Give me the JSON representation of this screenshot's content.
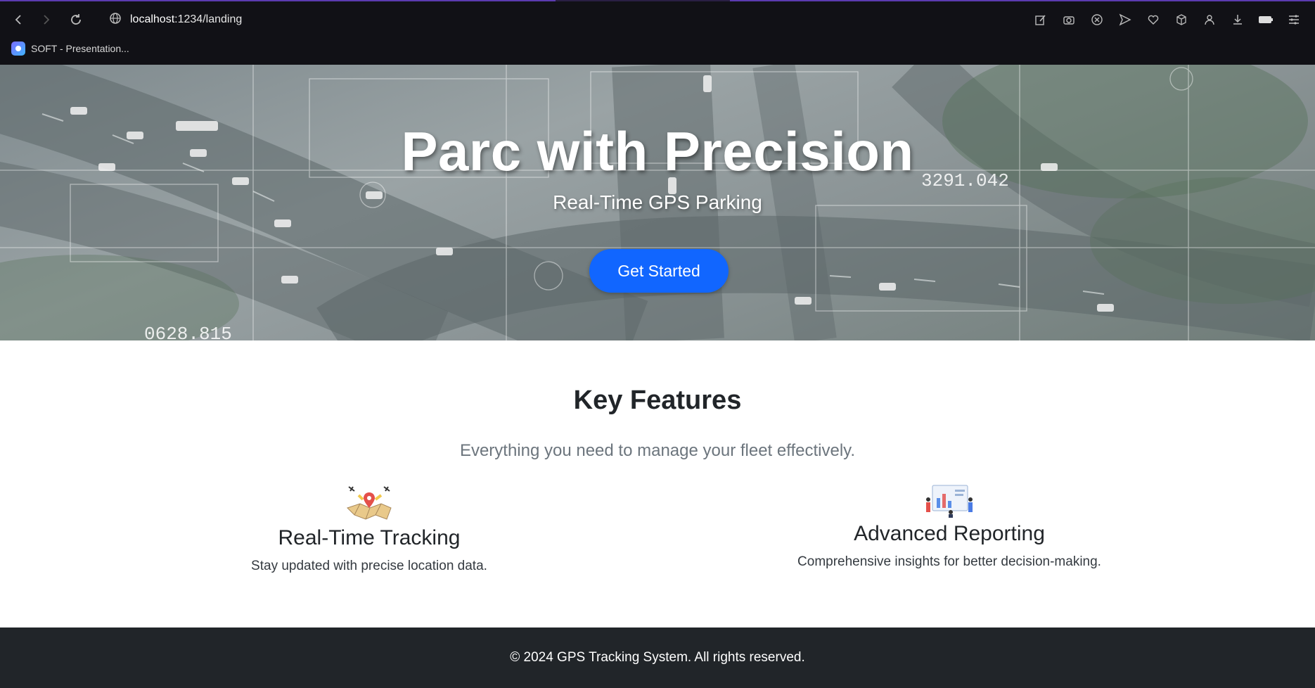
{
  "browser": {
    "url_host": "localhost",
    "url_path": ":1234/landing",
    "bookmark_label": "SOFT - Presentation..."
  },
  "hero": {
    "title": "Parc with Precision",
    "subtitle": "Real-Time GPS Parking",
    "cta_label": "Get Started",
    "overlay_number_right": "3291.042",
    "overlay_number_left": "0628.815"
  },
  "features": {
    "title": "Key Features",
    "subtitle": "Everything you need to manage your fleet effectively.",
    "items": [
      {
        "title": "Real-Time Tracking",
        "description": "Stay updated with precise location data."
      },
      {
        "title": "Advanced Reporting",
        "description": "Comprehensive insights for better decision-making."
      }
    ]
  },
  "footer": {
    "text": "© 2024 GPS Tracking System. All rights reserved."
  },
  "colors": {
    "primary": "#1166ff",
    "footer_bg": "#212529",
    "chrome_bg": "#111116"
  }
}
